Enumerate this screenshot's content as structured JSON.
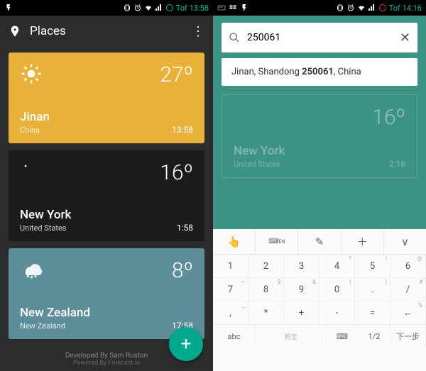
{
  "left": {
    "status": {
      "time": "Tof 13:58"
    },
    "appbar": {
      "title": "Places"
    },
    "cards": [
      {
        "city": "Jinan",
        "country": "China",
        "temp": "27º",
        "time": "13:58"
      },
      {
        "city": "New York",
        "country": "United States",
        "temp": "16º",
        "time": "1:58"
      },
      {
        "city": "New Zealand",
        "country": "New Zealand",
        "temp": "8º",
        "time": "17:58"
      }
    ],
    "fab": "+",
    "footer": {
      "line1": "Developed By Sam Ruston",
      "line2": "Powered By Forecast.io"
    }
  },
  "right": {
    "status": {
      "time": "Tof 14:16"
    },
    "search": {
      "value": "250061"
    },
    "suggestion": {
      "pre": "Jinan, Shandong ",
      "bold": "250061",
      "post": ", China"
    },
    "ghost": {
      "city": "New York",
      "country": "United States",
      "temp": "16º",
      "time": "2:16"
    },
    "keyboard": {
      "rows": [
        [
          "1",
          "2",
          "3",
          "4",
          "5",
          "6"
        ],
        [
          "7",
          "8",
          "9",
          "0",
          ".",
          "/"
        ],
        [
          ",",
          "*",
          "+",
          "-",
          "=",
          "←"
        ]
      ],
      "sups": [
        [
          "",
          "",
          "",
          "?",
          "!",
          "@"
        ],
        [
          "~",
          "$",
          "&",
          "(",
          ")",
          "#"
        ],
        [
          "_",
          "·",
          "",
          "",
          "",
          "%"
        ]
      ],
      "bottom": [
        "abc",
        "",
        "⌨",
        "1/2",
        "下一步"
      ]
    }
  }
}
